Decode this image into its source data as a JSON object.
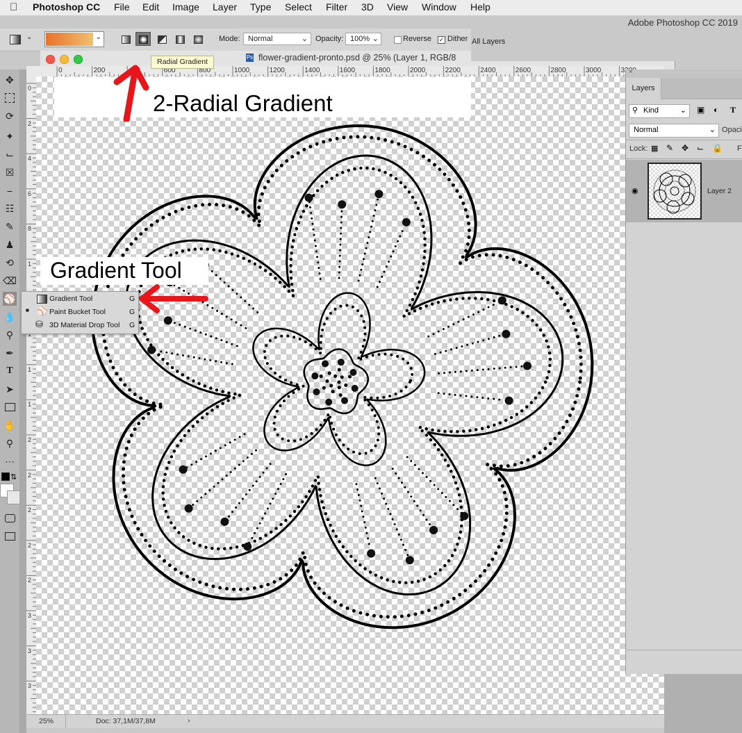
{
  "menubar": {
    "apple": "",
    "app_name": "Photoshop CC",
    "items": [
      "File",
      "Edit",
      "Image",
      "Layer",
      "Type",
      "Select",
      "Filter",
      "3D",
      "View",
      "Window",
      "Help"
    ]
  },
  "app_title": "Adobe Photoshop CC 2019",
  "options_bar": {
    "mode_label": "Mode:",
    "mode_value": "Normal",
    "opacity_label": "Opacity:",
    "opacity_value": "100%",
    "reverse_label": "Reverse",
    "dither_label": "Dither",
    "all_layers_label": "All Layers",
    "tooltip": "Radial Gradient",
    "gradient_colors": [
      "#e8722c",
      "#f0c070"
    ]
  },
  "document": {
    "title": "flower-gradient-pronto.psd @ 25% (Layer 1, RGB/8",
    "ruler_top_labels": [
      "0",
      "200",
      "400",
      "600",
      "800",
      "1000",
      "1200",
      "1400",
      "1600",
      "1800",
      "2000",
      "2200",
      "2400",
      "2600",
      "2800",
      "3000",
      "3200"
    ],
    "ruler_left_labels": [
      "0",
      "2",
      "4",
      "6",
      "8",
      "1",
      "1",
      "1",
      "1",
      "1",
      "2",
      "2",
      "2",
      "2",
      "2",
      "3",
      "3",
      "3"
    ],
    "zoom": "25%",
    "doc_info": "Doc: 37,1M/37,8M"
  },
  "annotations": {
    "radial": "2-Radial Gradient",
    "gradient_tool": "Gradient Tool"
  },
  "flyout": {
    "items": [
      {
        "label": "Gradient Tool",
        "key": "G"
      },
      {
        "label": "Paint Bucket Tool",
        "key": "G"
      },
      {
        "label": "3D Material Drop Tool",
        "key": "G"
      }
    ]
  },
  "layers_panel": {
    "tab": "Layers",
    "filter_value": "Kind",
    "blend_value": "Normal",
    "opacity_label": "Opacity",
    "lock_label": "Lock:",
    "fill_label": "Fi",
    "layer_name": "Layer 2"
  },
  "colors": {
    "arrow": "#e8151b",
    "selected_layer": "#b3b3b3"
  }
}
